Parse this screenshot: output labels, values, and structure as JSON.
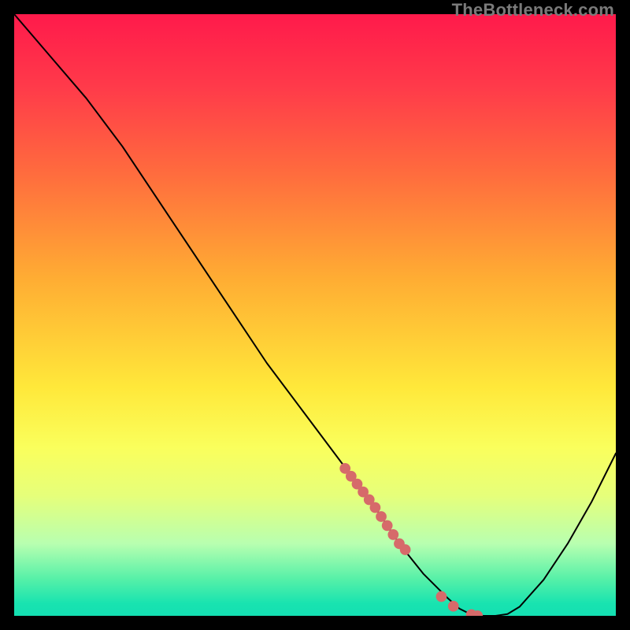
{
  "watermark": "TheBottleneck.com",
  "chart_data": {
    "type": "line",
    "title": "",
    "xlabel": "",
    "ylabel": "",
    "xlim": [
      0,
      100
    ],
    "ylim": [
      0,
      100
    ],
    "series": [
      {
        "name": "bottleneck-curve",
        "x": [
          0,
          6,
          12,
          18,
          22,
          26,
          30,
          36,
          42,
          48,
          54,
          60,
          64,
          68,
          72,
          74,
          76,
          78,
          80,
          82,
          84,
          88,
          92,
          96,
          100
        ],
        "y": [
          100,
          93,
          86,
          78,
          72,
          66,
          60,
          51,
          42,
          34,
          26,
          18,
          12,
          7,
          3,
          1.2,
          0.2,
          0,
          0,
          0.3,
          1.5,
          6,
          12,
          19,
          27
        ]
      }
    ],
    "highlight_points": {
      "name": "selected-range",
      "color": "#d66a6a",
      "x": [
        55,
        56,
        57,
        58,
        59,
        60,
        61,
        62,
        63,
        64,
        65,
        71,
        73,
        76,
        77
      ],
      "y": [
        24.5,
        23.2,
        21.9,
        20.6,
        19.3,
        18,
        16.5,
        15,
        13.5,
        12,
        11,
        3.2,
        1.6,
        0.2,
        0
      ]
    },
    "background_gradient": {
      "top": "#ff1a4b",
      "mid": "#ffe83a",
      "bottom": "#14dfb2"
    }
  }
}
